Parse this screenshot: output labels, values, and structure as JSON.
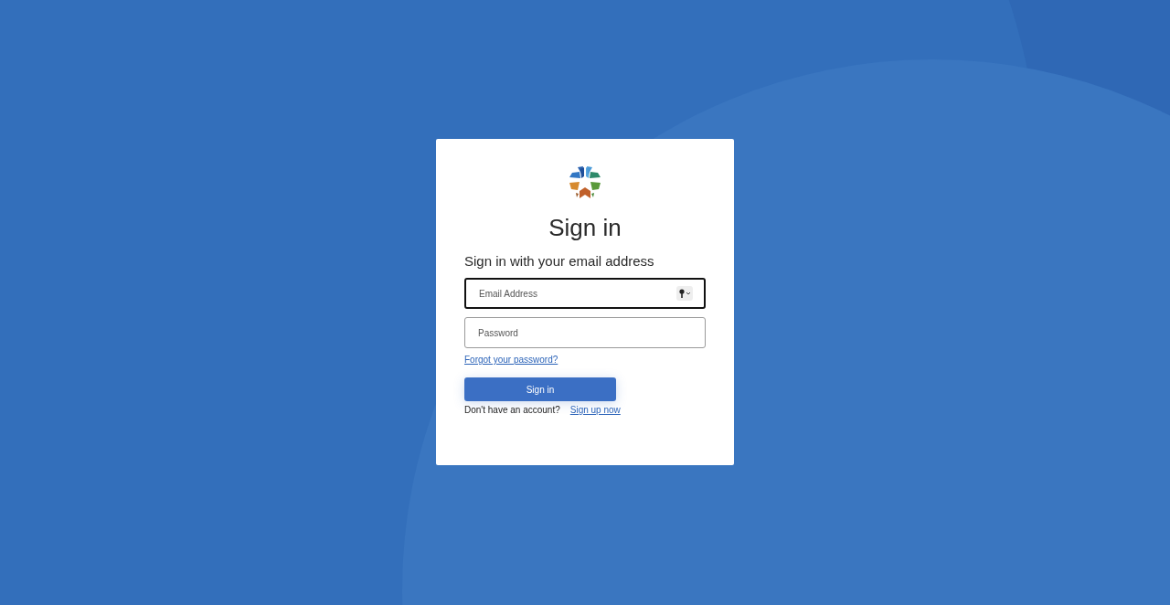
{
  "card": {
    "title": "Sign in",
    "subtitle": "Sign in with your email address",
    "fields": [
      {
        "placeholder": "Email Address",
        "focused": true,
        "key_icon": true
      },
      {
        "placeholder": "Password",
        "focused": false,
        "key_icon": false
      }
    ],
    "forgot_link": "Forgot your password?",
    "submit_button": "Sign in",
    "signup_prompt": "Don't have an account?",
    "signup_link": "Sign up now"
  }
}
